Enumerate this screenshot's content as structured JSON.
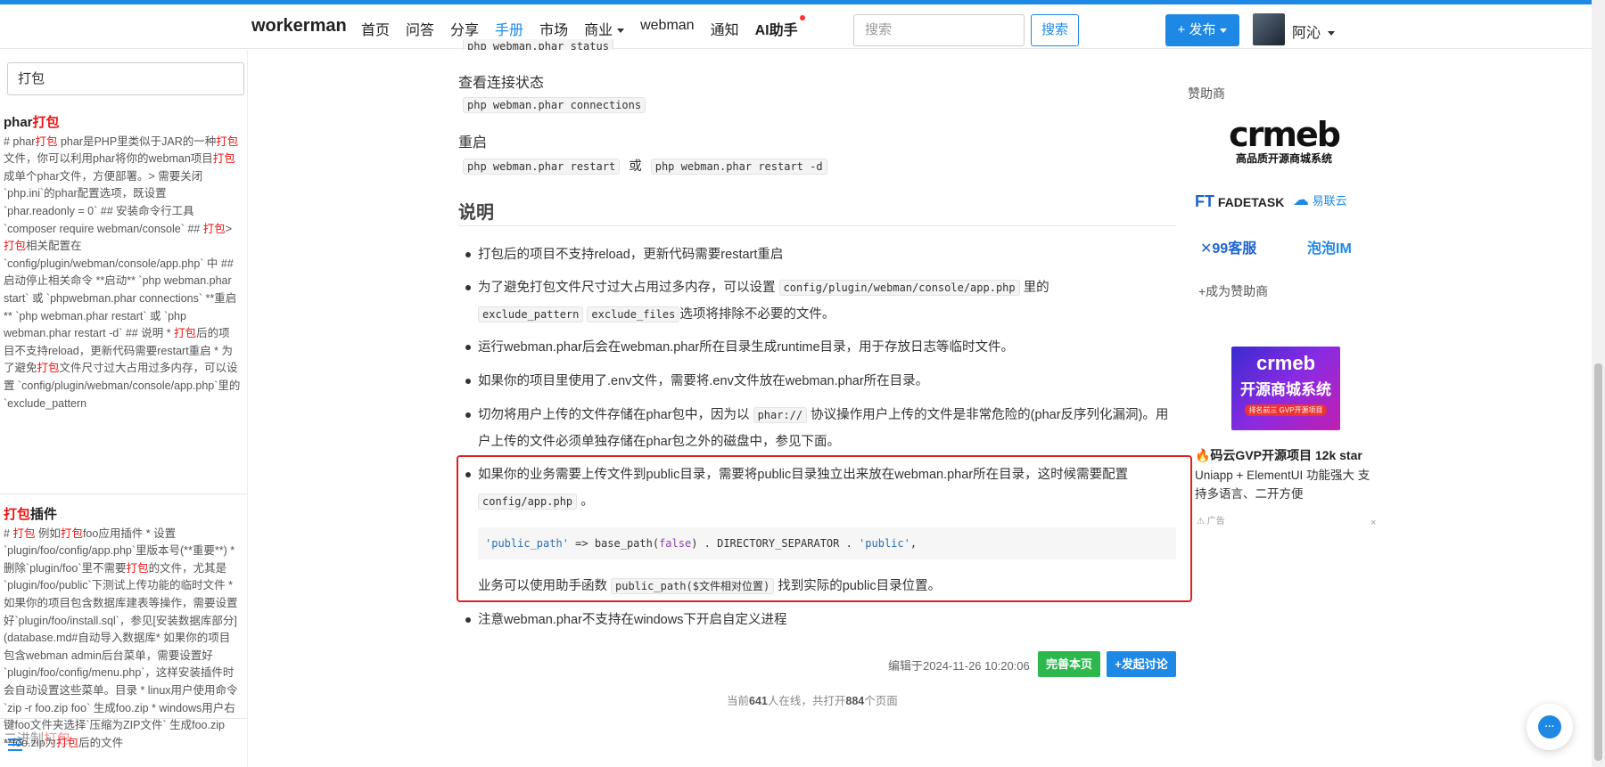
{
  "nav": {
    "brand": "workerman",
    "items": [
      {
        "label": "首页"
      },
      {
        "label": "问答"
      },
      {
        "label": "分享"
      },
      {
        "label": "手册"
      },
      {
        "label": "市场"
      },
      {
        "label": "商业"
      },
      {
        "label": "webman"
      },
      {
        "label": "通知"
      },
      {
        "label": "AI助手"
      }
    ],
    "search_placeholder": "搜索",
    "search_button": "搜索",
    "publish_button": "+ 发布",
    "username": "阿沁"
  },
  "sidebar": {
    "search_value": "打包",
    "results": [
      {
        "title_pre": "phar",
        "title_hl": "打包",
        "body": "# phar打包 phar是PHP里类似于JAR的一种打包文件，你可以利用phar将你的webman项目打包成单个phar文件，方便部署。> 需要关闭 `php.ini`的phar配置选项，既设置 `phar.readonly = 0` ## 安装命令行工具 `composer require webman/console` ## 打包> 打包相关配置在 `config/plugin/webman/console/app.php` 中 ## 启动停止相关命令 **启动** `php webman.phar start` 或 `phpwebman.phar connections` **重启** `php webman.phar restart` 或 `php webman.phar restart -d` ## 说明 * 打包后的项目不支持reload，更新代码需要restart重启 * 为了避免打包文件尺寸过大占用过多内存，可以设置 `config/plugin/webman/console/app.php`里的 `exclude_pattern"
      },
      {
        "title_pre": "",
        "title_hl": "打包",
        "title_post": "插件",
        "body": "# 打包 例如打包foo应用插件 * 设置 `plugin/foo/config/app.php`里版本号(**重要**) * 删除`plugin/foo`里不需要打包的文件，尤其是`plugin/foo/public`下测试上传功能的临时文件 * 如果你的项目包含数据库建表等操作，需要设置好`plugin/foo/install.sql`，参见[安装数据库部分](database.md#自动导入数据库* 如果你的项目包含webman admin后台菜单，需要设置好 `plugin/foo/config/menu.php`，这样安装插件时会自动设置这些菜单。目录 * linux用户使用命令 `zip -r foo.zip foo` 生成foo.zip * windows用户右键foo文件夹选择`压缩为ZIP文件` 生成foo.zip **foo.zip为打包后的文件"
      },
      {
        "title_pre": "二进制",
        "title_hl": "打包"
      }
    ]
  },
  "content": {
    "top_code_partial": "php webman.phar status",
    "h_status": "查看连接状态",
    "code_connections": "php webman.phar connections",
    "h_restart": "重启",
    "code_restart": "php webman.phar restart",
    "or": "或",
    "code_restart_d": "php webman.phar restart -d",
    "h_notes": "说明",
    "li1": "打包后的项目不支持reload，更新代码需要restart重启",
    "li2_a": "为了避免打包文件尺寸过大占用过多内存，可以设置",
    "li2_code1": "config/plugin/webman/console/app.php",
    "li2_b": "里的",
    "li2_code2": "exclude_pattern",
    "li2_code3": "exclude_files",
    "li2_c": "选项将排除不必要的文件。",
    "li3": "运行webman.phar后会在webman.phar所在目录生成runtime目录，用于存放日志等临时文件。",
    "li4": "如果你的项目里使用了.env文件，需要将.env文件放在webman.phar所在目录。",
    "li5_a": "切勿将用户上传的文件存储在phar包中，因为以",
    "li5_code": "phar://",
    "li5_b": "协议操作用户上传的文件是非常危险的(phar反序列化漏洞)。用户上传的文件必须单独存储在phar包之外的磁盘中，参见下面。",
    "li6_a": "如果你的业务需要上传文件到public目录，需要将public目录独立出来放在webman.phar所在目录，这时候需要配置",
    "li6_code": "config/app.php",
    "li6_b": "。",
    "cb_str1": "'public_path'",
    "cb_arrow": " => ",
    "cb_fn": "base_path(",
    "cb_false": "false",
    "cb_mid": ") . DIRECTORY_SEPARATOR . ",
    "cb_str2": "'public'",
    "cb_end": ",",
    "li6_c": "业务可以使用助手函数",
    "li6_code2": "public_path($文件相对位置)",
    "li6_d": "找到实际的public目录位置。",
    "li7": "注意webman.phar不支持在windows下开启自定义进程",
    "edited": "编辑于2024-11-26 10:20:06",
    "btn_improve": "完善本页",
    "btn_discuss": "+发起讨论",
    "online_pre": "当前",
    "online_count": "641",
    "online_mid": "人在线，共打开",
    "online_pages": "884",
    "online_post": "个页面"
  },
  "right": {
    "sponsor_title": "赞助商",
    "crmeb_logo": "crmeb",
    "crmeb_tag": "高品质开源商城系统",
    "fadetask_mark": "FT",
    "fadetask": "FADETASK",
    "yilianyun": "易联云",
    "kf99": "✕99客服",
    "paopao": "泡泡IM",
    "become_sponsor": "+成为赞助商",
    "ad_img_t1": "crmeb",
    "ad_img_t2": "开源商城系统",
    "ad_img_t3": "排名前三 GVP开源项目",
    "ad_title": "🔥码云GVP开源项目 12k star",
    "ad_desc": "Uniapp + ElementUI 功能强大 支持多语言、二开方便",
    "ad_label": "广告",
    "ad_close": "×"
  }
}
